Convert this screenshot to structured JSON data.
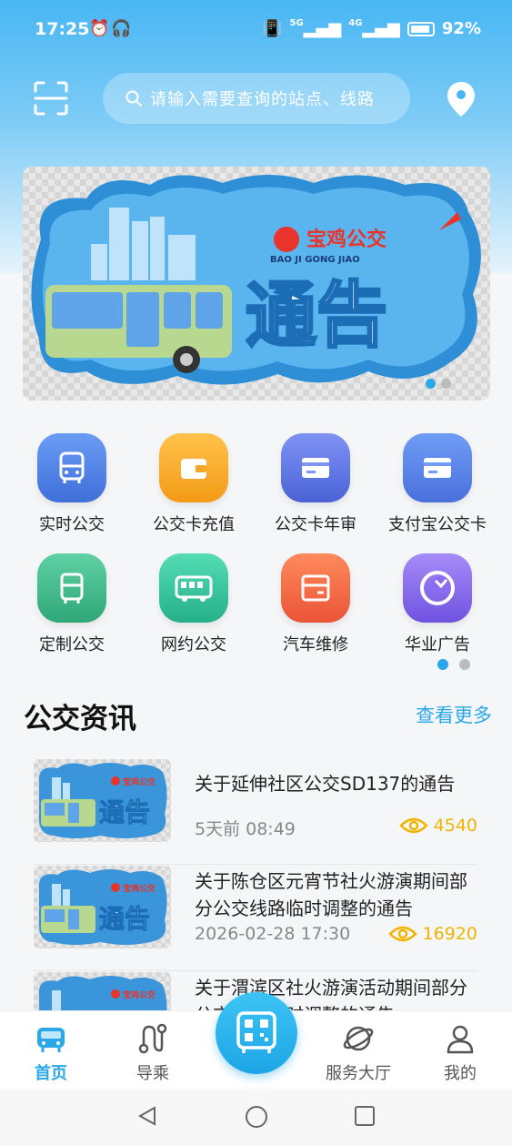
{
  "status_bar": {
    "time": "17:25",
    "battery": "92%",
    "net1": "5G",
    "net2": "4G"
  },
  "search": {
    "placeholder": "请输入需要查询的站点、线路"
  },
  "banner": {
    "brand": "宝鸡公交",
    "brand_sub": "BAO JI GONG JIAO",
    "headline": "通告"
  },
  "grid": {
    "items": [
      {
        "label": "实时公交",
        "icon": "bus-front-icon",
        "color": "#4c7ee6"
      },
      {
        "label": "公交卡充值",
        "icon": "wallet-icon",
        "color": "#f5a623"
      },
      {
        "label": "公交卡年审",
        "icon": "card-icon",
        "color": "#5b73e0"
      },
      {
        "label": "支付宝公交卡",
        "icon": "alipay-card-icon",
        "color": "#4c7ee6"
      },
      {
        "label": "定制公交",
        "icon": "custom-bus-icon",
        "color": "#36b98c"
      },
      {
        "label": "网约公交",
        "icon": "ride-bus-icon",
        "color": "#2fc29a"
      },
      {
        "label": "汽车维修",
        "icon": "repair-box-icon",
        "color": "#f26a4b"
      },
      {
        "label": "华业广告",
        "icon": "ad-logo-icon",
        "color": "#8a6cf0"
      }
    ]
  },
  "news": {
    "title": "公交资讯",
    "more": "查看更多",
    "items": [
      {
        "title": "关于延伸社区公交SD137的通告",
        "time": "5天前  08:49",
        "views": "4540"
      },
      {
        "title": "关于陈仓区元宵节社火游演期间部分公交线路临时调整的通告",
        "time": "2026-02-28 17:30",
        "views": "16920"
      },
      {
        "title": "关于渭滨区社火游演活动期间部分公交线路临时调整的通告",
        "time": "",
        "views": ""
      }
    ]
  },
  "nav": {
    "home": "首页",
    "guide": "导乘",
    "service": "服务大厅",
    "mine": "我的"
  },
  "colors": {
    "accent": "#2aa7e8",
    "views": "#f0b400"
  }
}
